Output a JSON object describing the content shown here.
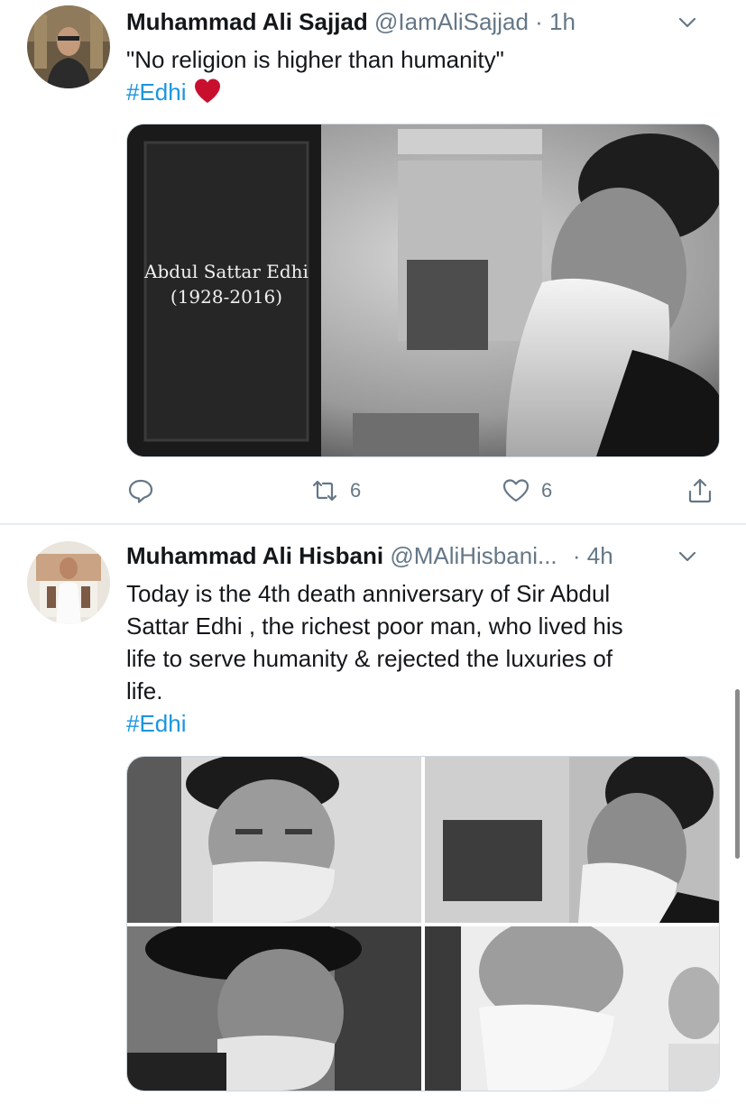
{
  "tweets": [
    {
      "name": "Muhammad Ali Sajjad",
      "handle": "@IamAliSajjad",
      "dot": "·",
      "time": "1h",
      "text": "\"No religion is higher than humanity\"",
      "hashtag": "#Edhi",
      "media": {
        "caption_line1": "Abdul Sattar Edhi",
        "caption_line2": "(1928-2016)"
      },
      "actions": {
        "reply_count": "",
        "retweet_count": "6",
        "like_count": "6"
      }
    },
    {
      "name": "Muhammad Ali Hisbani",
      "handle": "@MAliHisbani...",
      "dot": "·",
      "time": "4h",
      "text_lines": [
        "Today is the 4th death anniversary of Sir Abdul",
        "Sattar Edhi , the richest poor man, who lived his",
        "life to serve humanity & rejected the luxuries of",
        "life."
      ],
      "hashtag": "#Edhi"
    }
  ],
  "colors": {
    "link": "#1b95e0",
    "secondary_text": "#657786",
    "heart": "#c8102e",
    "divider": "#e6ecf0"
  },
  "icons": {
    "reply": "speech-bubble-icon",
    "retweet": "retweet-icon",
    "like": "heart-outline-icon",
    "share": "share-icon",
    "menu": "chevron-down-icon"
  }
}
